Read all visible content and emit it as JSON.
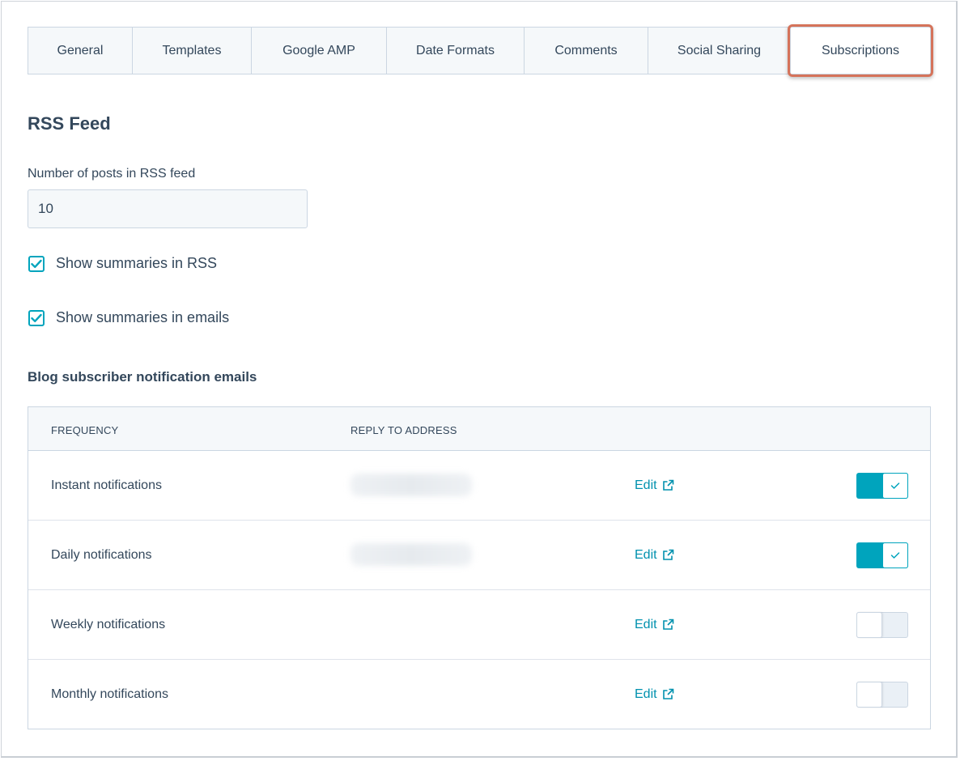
{
  "tabs": [
    {
      "label": "General",
      "active": false
    },
    {
      "label": "Templates",
      "active": false
    },
    {
      "label": "Google AMP",
      "active": false
    },
    {
      "label": "Date Formats",
      "active": false
    },
    {
      "label": "Comments",
      "active": false
    },
    {
      "label": "Social Sharing",
      "active": false
    },
    {
      "label": "Subscriptions",
      "active": true
    }
  ],
  "rss": {
    "title": "RSS Feed",
    "posts_label": "Number of posts in RSS feed",
    "posts_value": "10",
    "show_summaries_rss": {
      "label": "Show summaries in RSS",
      "checked": true
    },
    "show_summaries_emails": {
      "label": "Show summaries in emails",
      "checked": true
    }
  },
  "notifications": {
    "title": "Blog subscriber notification emails",
    "columns": {
      "frequency": "FREQUENCY",
      "reply_to": "REPLY TO ADDRESS"
    },
    "rows": [
      {
        "frequency": "Instant notifications",
        "reply_to_blurred": true,
        "edit_label": "Edit",
        "enabled": true
      },
      {
        "frequency": "Daily notifications",
        "reply_to_blurred": true,
        "edit_label": "Edit",
        "enabled": true
      },
      {
        "frequency": "Weekly notifications",
        "reply_to_blurred": false,
        "edit_label": "Edit",
        "enabled": false
      },
      {
        "frequency": "Monthly notifications",
        "reply_to_blurred": false,
        "edit_label": "Edit",
        "enabled": false
      }
    ]
  },
  "colors": {
    "accent": "#00a4bd",
    "link": "#0091ae",
    "text": "#33475b",
    "highlight": "#d5735a",
    "border": "#cbd6e2"
  },
  "icons": {
    "checkbox": "checkmark-icon",
    "edit": "external-link-icon",
    "toggle_on": "checkmark-icon"
  }
}
